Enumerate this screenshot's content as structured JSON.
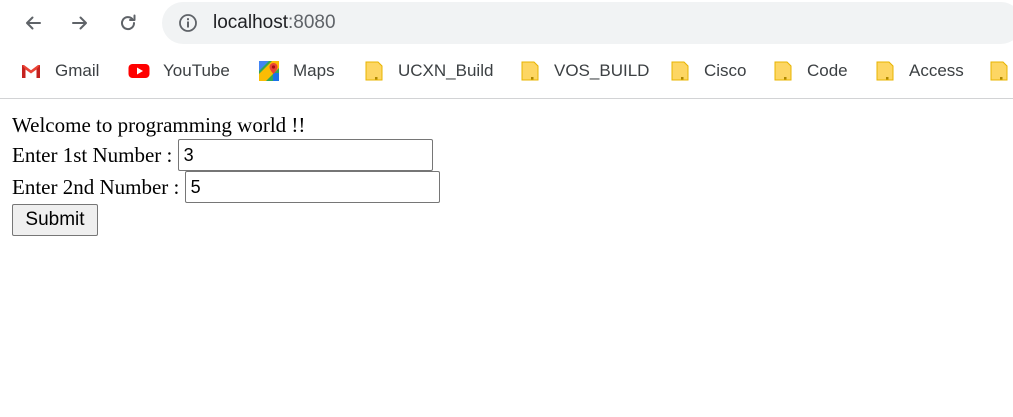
{
  "browser": {
    "url_host": "localhost",
    "url_port": ":8080",
    "bookmarks": [
      {
        "label": "Gmail",
        "icon": "gmail-icon"
      },
      {
        "label": "YouTube",
        "icon": "youtube-icon"
      },
      {
        "label": "Maps",
        "icon": "maps-icon"
      },
      {
        "label": "UCXN_Build",
        "icon": "folder-icon"
      },
      {
        "label": "VOS_BUILD",
        "icon": "folder-icon"
      },
      {
        "label": "Cisco",
        "icon": "folder-icon"
      },
      {
        "label": "Code",
        "icon": "folder-icon"
      },
      {
        "label": "Access",
        "icon": "folder-icon"
      }
    ],
    "colors": {
      "omnibox_bg": "#f1f3f4",
      "folder_yellow": "#fdd663"
    }
  },
  "page": {
    "heading": "Welcome to programming world !!",
    "field1": {
      "label": "Enter 1st Number :",
      "value": "3"
    },
    "field2": {
      "label": "Enter 2nd Number :",
      "value": "5"
    },
    "submit_label": "Submit"
  }
}
